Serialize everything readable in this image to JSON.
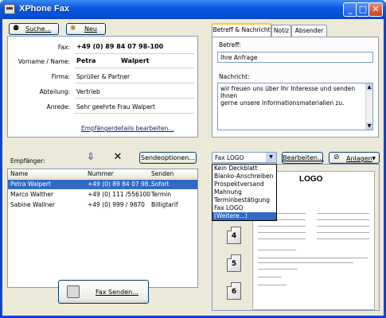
{
  "window": {
    "title": "XPhone Fax"
  },
  "toolbar": {
    "search_label": "Suche...",
    "new_label": "Neu"
  },
  "recipient": {
    "fax_label": "Fax:",
    "fax_value": "+49 (0) 89 84 07 98-100",
    "name_label": "Vorname / Name:",
    "first_name": "Petra",
    "last_name": "Walpert",
    "company_label": "Firma:",
    "company_value": "Sprüller & Partner",
    "department_label": "Abteilung:",
    "department_value": "Vertrieb",
    "salutation_label": "Anrede:",
    "salutation_value": "Sehr geehrte Frau Walpert",
    "edit_link": "Empfängerdetails bearbeiten..."
  },
  "tabs": [
    {
      "label": "Betreff & Nachricht",
      "active": true
    },
    {
      "label": "Notiz",
      "active": false
    },
    {
      "label": "Absender",
      "active": false
    }
  ],
  "message": {
    "subject_label": "Betreff:",
    "subject_value": "Ihre Anfrage",
    "body_label": "Nachricht:",
    "body_line1": "wir freuen uns über Ihr Interesse und senden Ihnen",
    "body_line2": "gerne unsere Informationsmaterialien zu."
  },
  "recipients_list": {
    "label": "Empfänger:",
    "send_options_label": "Sendeoptionen...",
    "columns": [
      "Name",
      "Nummer",
      "Senden"
    ],
    "rows": [
      {
        "name": "Petra Walpert",
        "number": "+49 (0) 89 84 07 98...",
        "send": "Sofort",
        "selected": true
      },
      {
        "name": "Marco Walther",
        "number": "+49 (0) 111 /556100",
        "send": "Termin",
        "selected": false
      },
      {
        "name": "Sabine Wallner",
        "number": "+49 (0) 999 / 9870",
        "send": "Billigtarif",
        "selected": false
      }
    ]
  },
  "cover": {
    "selected": "Fax LOGO",
    "edit_label": "Bearbeiten...",
    "attachments_label": "Anlagen",
    "options": [
      "Kein Deckblatt",
      "Blanko-Anschreiben",
      "Prospektversand",
      "Mahnung",
      "Terminbestätigung",
      "Fax LOGO",
      "(Weitere...)"
    ],
    "highlighted_index": 6,
    "preview_logo": "LOGO",
    "pages": [
      "4",
      "5",
      "6"
    ]
  },
  "send_button": {
    "label": "Fax Senden..."
  }
}
